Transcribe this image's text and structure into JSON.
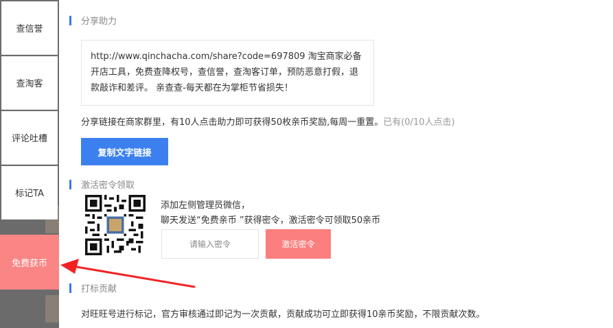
{
  "sidebar": {
    "items": [
      {
        "label": "查信誉"
      },
      {
        "label": "查淘客"
      },
      {
        "label": "评论吐槽"
      },
      {
        "label": "标记TA"
      },
      {
        "label": "免费获币"
      }
    ]
  },
  "share": {
    "title": "分享助力",
    "text": "http://www.qinchacha.com/share?code=697809 淘宝商家必备开店工具，免费查降权号，查信誉，查淘客订单，预防恶意打假，退款敲诈和差评。 亲查查-每天都在为掌柜节省损失！",
    "note": "分享链接在商家群里，有10人点击助力即可获得50枚亲币奖励,每周一重置。",
    "progress": "已有(0/10人点击)",
    "copy_button": "复制文字链接"
  },
  "activation": {
    "title": "激活密令领取",
    "line1": "添加左侧管理员微信，",
    "line2": "聊天发送“免费亲币 ”获得密令，激活密令可领取50亲币",
    "input_placeholder": "请输入密令",
    "activate_button": "激活密令"
  },
  "contribution": {
    "title": "打标贡献",
    "text": "对旺旺号进行标记，官方审核通过即记为一次贡献，贡献成功可立即获得10亲币奖励，不限贡献次数。"
  },
  "colors": {
    "accent_blue": "#3c80f0",
    "accent_red": "#fc7f7f",
    "arrow_red": "#f22222"
  }
}
